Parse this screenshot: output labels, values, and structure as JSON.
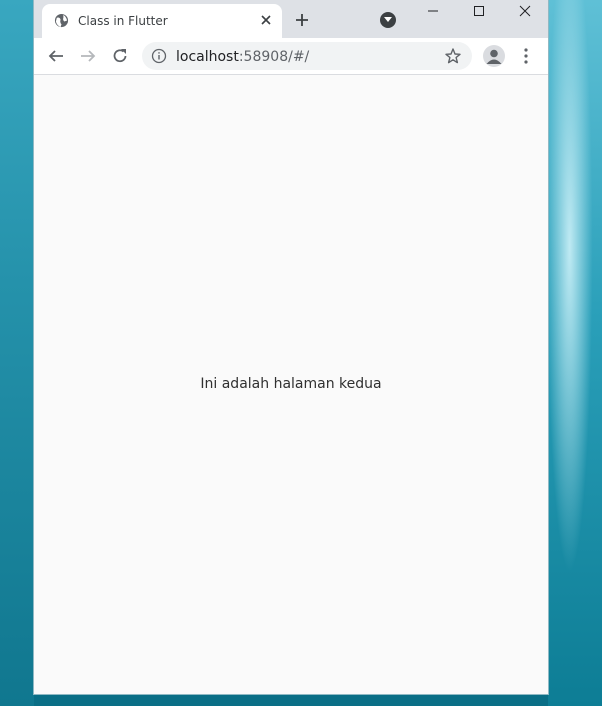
{
  "browser": {
    "tab": {
      "title": "Class in Flutter",
      "favicon": "globe-icon"
    },
    "address_bar": {
      "host": "localhost",
      "rest": ":58908/#/"
    },
    "icons": {
      "back": "arrow-left-icon",
      "forward": "arrow-right-icon",
      "reload": "reload-icon",
      "info": "info-icon",
      "star": "star-icon",
      "profile": "person-icon",
      "menu": "kebab-menu-icon",
      "new_tab": "plus-icon",
      "tab_search": "chevron-down-icon",
      "close_tab": "close-icon",
      "minimize": "minimize-icon",
      "maximize": "maximize-icon",
      "close_window": "close-icon"
    },
    "colors": {
      "titlebar": "#dee1e6",
      "toolbar": "#ffffff",
      "omnibox": "#f1f3f4",
      "page_background": "#fafafa"
    }
  },
  "page": {
    "message": "Ini adalah halaman kedua"
  }
}
